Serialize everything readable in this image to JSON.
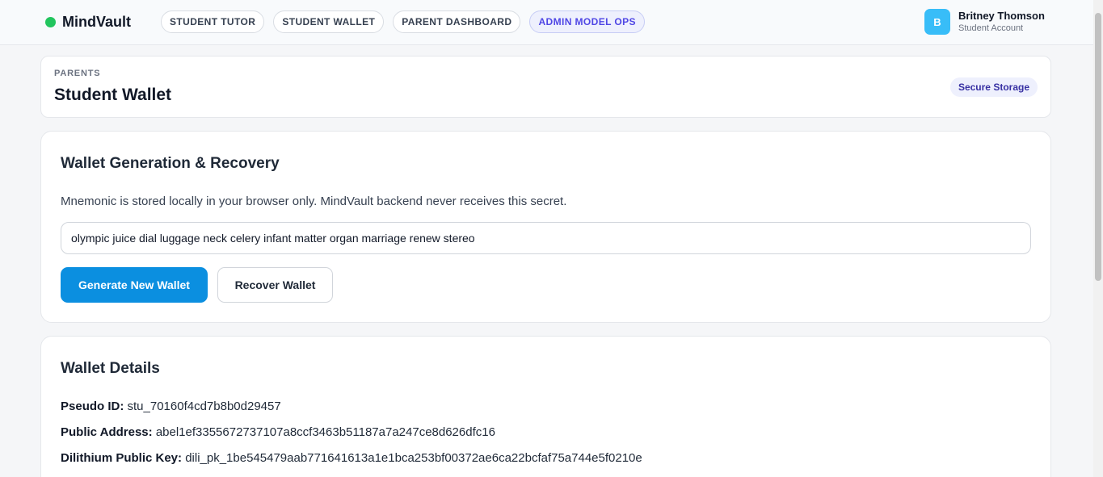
{
  "brand": {
    "name": "MindVault",
    "dot_color": "#22c55e"
  },
  "nav": [
    {
      "label": "STUDENT TUTOR",
      "active": false
    },
    {
      "label": "STUDENT WALLET",
      "active": false
    },
    {
      "label": "PARENT DASHBOARD",
      "active": false
    },
    {
      "label": "ADMIN MODEL OPS",
      "active": true
    }
  ],
  "user": {
    "initial": "B",
    "name": "Britney Thomson",
    "role": "Student Account"
  },
  "header": {
    "eyebrow": "PARENTS",
    "title": "Student Wallet",
    "badge": "Secure Storage"
  },
  "generation": {
    "title": "Wallet Generation & Recovery",
    "description": "Mnemonic is stored locally in your browser only. MindVault backend never receives this secret.",
    "mnemonic_value": "olympic juice dial luggage neck celery infant matter organ marriage renew stereo",
    "generate_label": "Generate New Wallet",
    "recover_label": "Recover Wallet"
  },
  "details": {
    "title": "Wallet Details",
    "rows": [
      {
        "label": "Pseudo ID:",
        "value": "stu_70160f4cd7b8b0d29457"
      },
      {
        "label": "Public Address:",
        "value": "abel1ef3355672737107a8ccf3463b51187a7a247ce8d626dfc16"
      },
      {
        "label": "Dilithium Public Key:",
        "value": "dili_pk_1be545479aab771641613a1e1bca253bf00372ae6ca22bcfaf75a744e5f0210e"
      }
    ]
  },
  "colors": {
    "accent": "#0b8fe0",
    "active_nav": "#4f46e5",
    "avatar": "#38bdf8"
  }
}
